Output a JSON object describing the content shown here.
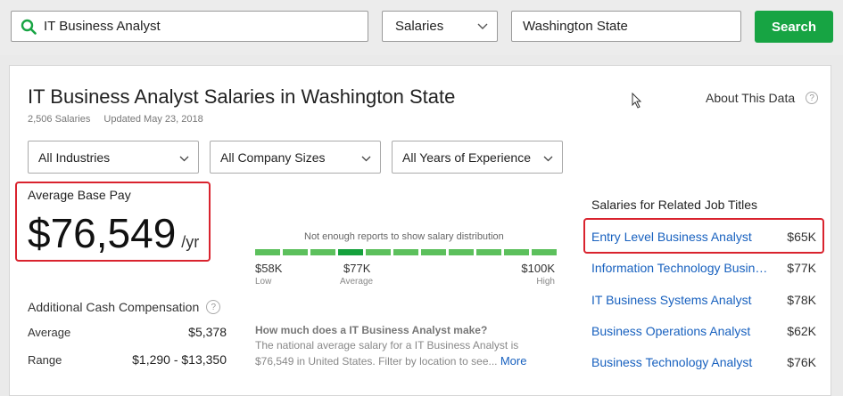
{
  "search": {
    "job_query": "IT Business Analyst",
    "type_selected": "Salaries",
    "location": "Washington State",
    "button_label": "Search"
  },
  "header": {
    "title": "IT Business Analyst Salaries in Washington State",
    "salary_count": "2,506 Salaries",
    "updated": "Updated May 23, 2018",
    "about_label": "About This Data",
    "help_glyph": "?"
  },
  "filters": {
    "industries": "All Industries",
    "company_sizes": "All Company Sizes",
    "experience": "All Years of Experience"
  },
  "average_pay": {
    "label": "Average Base Pay",
    "value": "$76,549",
    "unit": "/yr"
  },
  "distribution": {
    "note": "Not enough reports to show salary distribution",
    "low_value": "$58K",
    "low_label": "Low",
    "avg_value": "$77K",
    "avg_label": "Average",
    "high_value": "$100K",
    "high_label": "High",
    "bar_count": 11,
    "highlight_index": 3,
    "bar_color": "#5cc05c",
    "highlight_color": "#15a13c"
  },
  "additional": {
    "title": "Additional Cash Compensation",
    "help_glyph": "?",
    "average_label": "Average",
    "average_value": "$5,378",
    "range_label": "Range",
    "range_value": "$1,290 - $13,350"
  },
  "how_much": {
    "question": "How much does a IT Business Analyst make?",
    "answer": "The national average salary for a IT Business Analyst is $76,549 in United States. Filter by location to see...",
    "more_label": "More"
  },
  "related": {
    "title": "Salaries for Related Job Titles",
    "items": [
      {
        "name": "Entry Level Business Analyst",
        "pay": "$65K"
      },
      {
        "name": "Information Technology Business Analyst",
        "pay": "$77K"
      },
      {
        "name": "IT Business Systems Analyst",
        "pay": "$78K"
      },
      {
        "name": "Business Operations Analyst",
        "pay": "$62K"
      },
      {
        "name": "Business Technology Analyst",
        "pay": "$76K"
      }
    ]
  },
  "colors": {
    "accent_green": "#17a443",
    "link_blue": "#1861bf",
    "highlight_red": "#d9232e"
  }
}
